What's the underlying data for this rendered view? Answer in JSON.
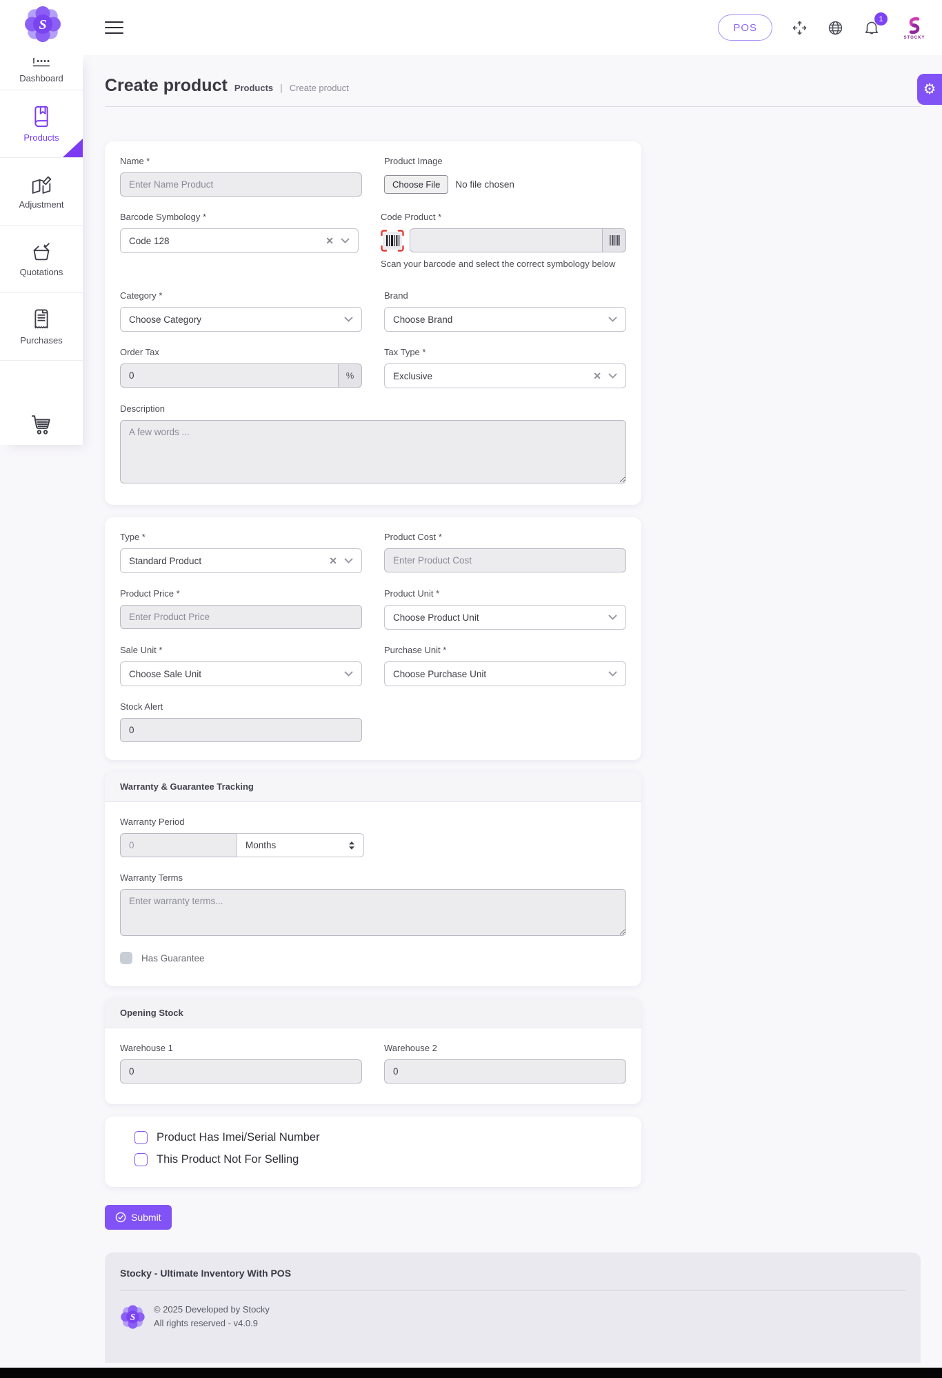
{
  "header": {
    "pos_label": "POS",
    "notification_badge": "1",
    "brand_caption": "STOCKY",
    "logo_letter": "S"
  },
  "sidebar": {
    "items": [
      {
        "label": "Dashboard"
      },
      {
        "label": "Products"
      },
      {
        "label": "Adjustment"
      },
      {
        "label": "Quotations"
      },
      {
        "label": "Purchases"
      },
      {
        "label": ""
      }
    ]
  },
  "page": {
    "title": "Create product",
    "breadcrumb_root": "Products",
    "breadcrumb_separator": "|",
    "breadcrumb_current": "Create product"
  },
  "form": {
    "name": {
      "label": "Name *",
      "placeholder": "Enter Name Product"
    },
    "product_image": {
      "label": "Product Image",
      "button": "Choose File",
      "status": "No file chosen"
    },
    "barcode_symbology": {
      "label": "Barcode Symbology *",
      "value": "Code 128"
    },
    "code_product": {
      "label": "Code Product *",
      "hint": "Scan your barcode and select the correct symbology below"
    },
    "category": {
      "label": "Category *",
      "value": "Choose Category"
    },
    "brand": {
      "label": "Brand",
      "value": "Choose Brand"
    },
    "order_tax": {
      "label": "Order Tax",
      "value": "0",
      "addon": "%"
    },
    "tax_type": {
      "label": "Tax Type *",
      "value": "Exclusive"
    },
    "description": {
      "label": "Description",
      "placeholder": "A few words ..."
    },
    "type": {
      "label": "Type *",
      "value": "Standard Product"
    },
    "product_cost": {
      "label": "Product Cost *",
      "placeholder": "Enter Product Cost"
    },
    "product_price": {
      "label": "Product Price *",
      "placeholder": "Enter Product Price"
    },
    "product_unit": {
      "label": "Product Unit *",
      "value": "Choose Product Unit"
    },
    "sale_unit": {
      "label": "Sale Unit *",
      "value": "Choose Sale Unit"
    },
    "purchase_unit": {
      "label": "Purchase Unit *",
      "value": "Choose Purchase Unit"
    },
    "stock_alert": {
      "label": "Stock Alert",
      "value": "0"
    },
    "warranty": {
      "card_title": "Warranty & Guarantee Tracking",
      "period_label": "Warranty Period",
      "period_value": "0",
      "period_unit": "Months",
      "terms_label": "Warranty Terms",
      "terms_placeholder": "Enter warranty terms...",
      "guarantee_label": "Has Guarantee"
    },
    "opening_stock": {
      "card_title": "Opening Stock",
      "warehouse1_label": "Warehouse 1",
      "warehouse1_value": "0",
      "warehouse2_label": "Warehouse 2",
      "warehouse2_value": "0"
    },
    "flags": {
      "imei_label": "Product Has Imei/Serial Number",
      "not_for_selling_label": "This Product Not For Selling"
    },
    "submit_label": "Submit"
  },
  "footer": {
    "title": "Stocky - Ultimate Inventory With POS",
    "copyright": "© 2025 Developed by Stocky",
    "rights": "All rights reserved - v4.0.9"
  },
  "colors": {
    "accent": "#7c3bf3",
    "accent_button": "#8152f5",
    "brand_pink": "#cf3db4"
  }
}
